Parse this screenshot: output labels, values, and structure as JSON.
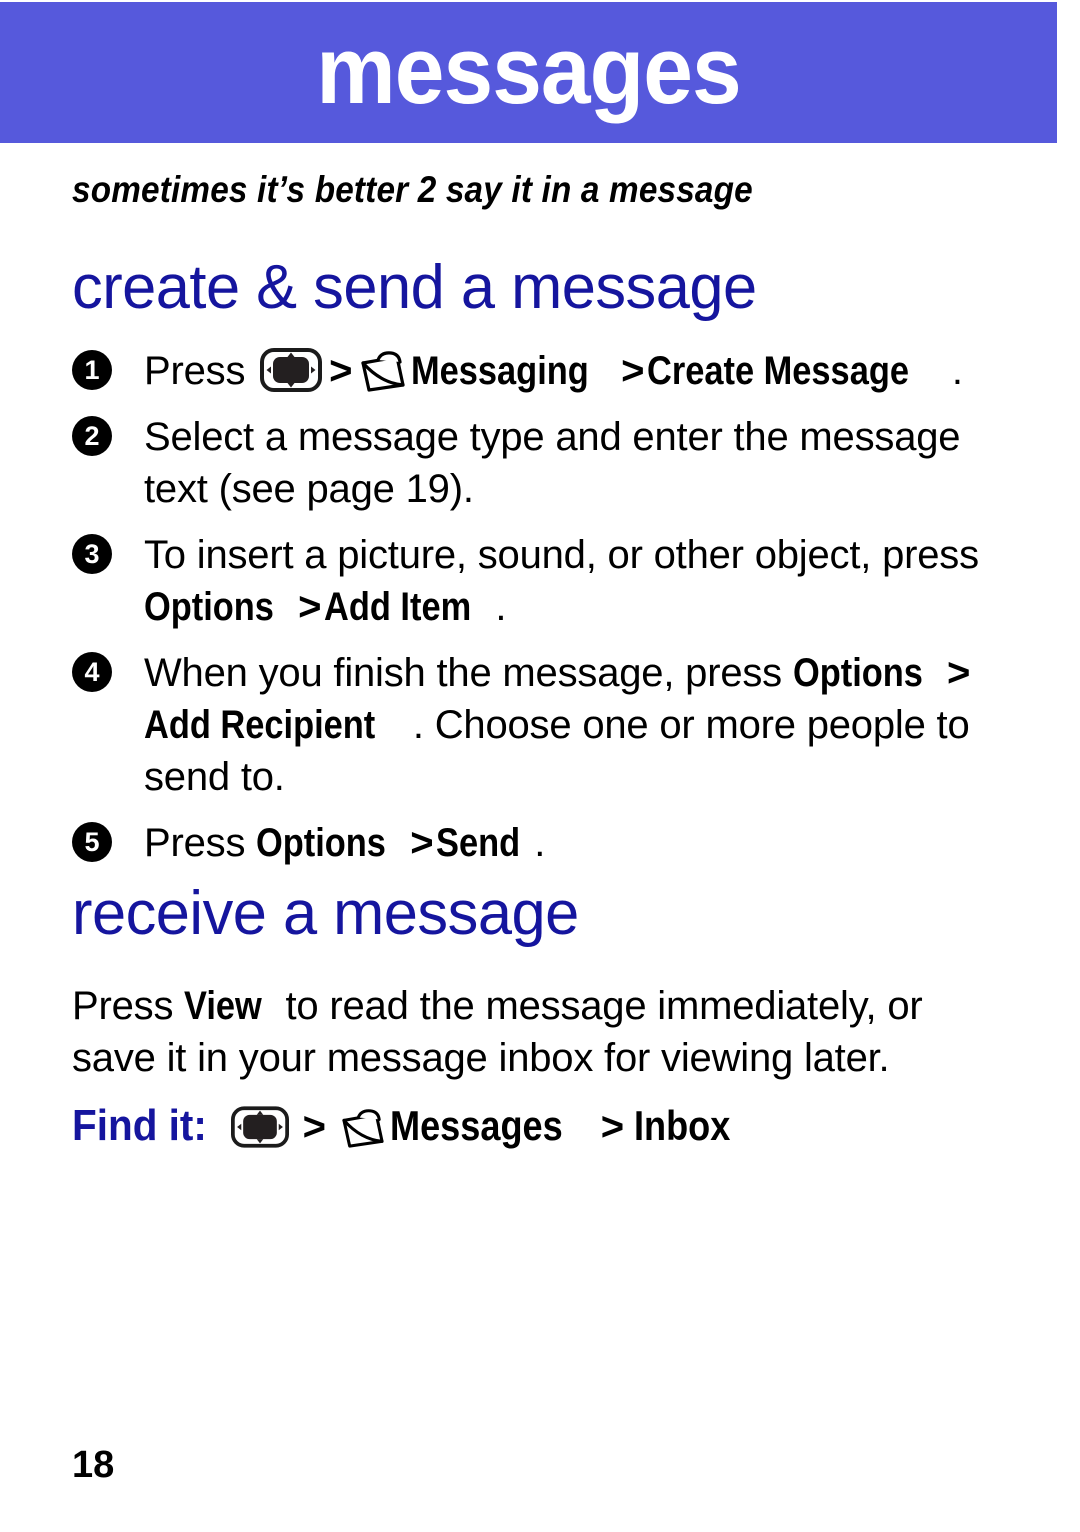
{
  "header": {
    "title": "messages",
    "banner_color": "#5659DC",
    "title_color": "#FFFFFF"
  },
  "tagline": "sometimes it’s better 2 say it in a message",
  "accent_color": "#15159E",
  "sections": [
    {
      "heading": "create & send a message",
      "steps": [
        {
          "number": "1",
          "parts": [
            {
              "type": "text",
              "value": "Press "
            },
            {
              "type": "icon",
              "value": "navigation-key-icon"
            },
            {
              "type": "gt",
              "value": ">"
            },
            {
              "type": "icon",
              "value": "envelope-icon"
            },
            {
              "type": "ui",
              "value": "Messaging"
            },
            {
              "type": "gt",
              "value": ">"
            },
            {
              "type": "ui",
              "value": "Create Message"
            },
            {
              "type": "text",
              "value": "."
            }
          ]
        },
        {
          "number": "2",
          "parts": [
            {
              "type": "text",
              "value": "Select a message type and enter the message text (see page 19)."
            }
          ]
        },
        {
          "number": "3",
          "parts": [
            {
              "type": "text",
              "value": "To insert a picture, sound, or other object, press "
            },
            {
              "type": "ui",
              "value": "Options"
            },
            {
              "type": "gt",
              "value": ">"
            },
            {
              "type": "ui",
              "value": "Add Item"
            },
            {
              "type": "text",
              "value": "."
            }
          ]
        },
        {
          "number": "4",
          "parts": [
            {
              "type": "text",
              "value": "When you finish the message, press "
            },
            {
              "type": "ui",
              "value": "Options"
            },
            {
              "type": "gt",
              "value": ">"
            },
            {
              "type": "ui",
              "value": "Add Recipient"
            },
            {
              "type": "text",
              "value": ". Choose one or more people to send to."
            }
          ]
        },
        {
          "number": "5",
          "parts": [
            {
              "type": "text",
              "value": "Press "
            },
            {
              "type": "ui",
              "value": "Options"
            },
            {
              "type": "gt",
              "value": ">"
            },
            {
              "type": "ui",
              "value": "Send"
            },
            {
              "type": "text",
              "value": "."
            }
          ]
        }
      ]
    },
    {
      "heading": "receive a message",
      "paragraph": [
        {
          "type": "text",
          "value": "Press "
        },
        {
          "type": "ui",
          "value": "View"
        },
        {
          "type": "text",
          "value": " to read the message immediately, or save it in your message inbox for viewing later."
        }
      ]
    }
  ],
  "find_it": {
    "label": "Find it:",
    "parts": [
      {
        "type": "icon",
        "value": "navigation-key-icon"
      },
      {
        "type": "gt",
        "value": ">"
      },
      {
        "type": "icon",
        "value": "envelope-icon"
      },
      {
        "type": "ui",
        "value": "Messages"
      },
      {
        "type": "gt",
        "value": ">"
      },
      {
        "type": "ui",
        "value": "Inbox"
      }
    ]
  },
  "footer": {
    "page_number": "18"
  }
}
